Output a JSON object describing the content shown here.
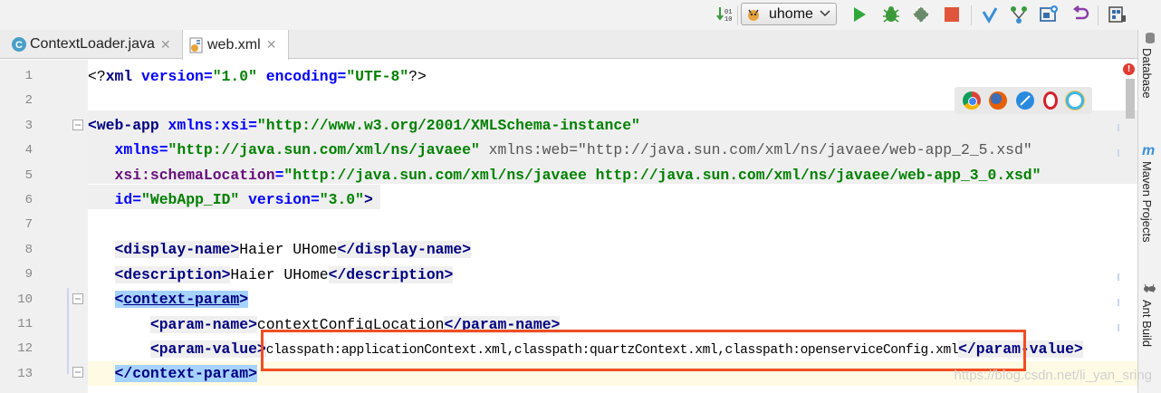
{
  "toolbar": {
    "run_config_label": "uhome",
    "icons": [
      "sort-icon",
      "run-config-icon",
      "run-icon",
      "debug-icon",
      "coverage-icon",
      "stop-icon",
      "vcs-update-icon",
      "vcs-branch-icon",
      "project-structure-icon",
      "revert-icon",
      "sdk-icon"
    ]
  },
  "tabs": [
    {
      "label": "ContextLoader.java",
      "icon": "java-class-icon",
      "active": false
    },
    {
      "label": "web.xml",
      "icon": "xml-file-icon",
      "active": true
    }
  ],
  "right_strip": {
    "database": "Database",
    "maven": "Maven Projects",
    "ant": "Ant Build"
  },
  "browsers": [
    "chrome-icon",
    "firefox-icon",
    "safari-icon",
    "opera-icon",
    "ie-icon"
  ],
  "line_numbers": [
    "1",
    "2",
    "3",
    "4",
    "5",
    "6",
    "7",
    "8",
    "9",
    "10",
    "11",
    "12",
    "13"
  ],
  "code": {
    "l1": {
      "open": "<?",
      "tag": "xml",
      "a1": " version",
      "eq1": "=",
      "v1": "\"1.0\"",
      "a2": " encoding",
      "eq2": "=",
      "v2": "\"UTF-8\"",
      "close": "?>"
    },
    "l3": {
      "lt": "<",
      "tag": "web-app",
      "sp": " ",
      "ns": "xmlns:xsi",
      "eq": "=",
      "v": "\"http://www.w3.org/2001/XMLSchema-instance\""
    },
    "l4": {
      "indent": "   ",
      "a": "xmlns",
      "eq": "=",
      "v": "\"http://java.sun.com/xml/ns/javaee\"",
      "a2": " xmlns:web",
      "eq2": "=",
      "v2": "\"http://java.sun.com/xml/ns/javaee/web-app_2_5.xsd\""
    },
    "l5": {
      "indent": "   ",
      "a": "xsi:schemaLocation",
      "eq": "=",
      "v": "\"http://java.sun.com/xml/ns/javaee http://java.sun.com/xml/ns/javaee/web-app_3_0.xsd\""
    },
    "l6": {
      "indent": "   ",
      "a": "id",
      "eq": "=",
      "v": "\"WebApp_ID\"",
      "a2": " version",
      "eq2": "=",
      "v2": "\"3.0\"",
      "close": ">"
    },
    "l8": {
      "indent": "   ",
      "lt": "<",
      "tag": "display-name",
      "gt": ">",
      "text": "Haier UHome",
      "lt2": "</",
      "tag2": "display-name",
      "gt2": ">"
    },
    "l9": {
      "indent": "   ",
      "lt": "<",
      "tag": "description",
      "gt": ">",
      "text": "Haier UHome",
      "lt2": "</",
      "tag2": "description",
      "gt2": ">"
    },
    "l10": {
      "indent": "   ",
      "lt": "<",
      "tag": "context-param",
      "gt": ">"
    },
    "l11": {
      "indent": "       ",
      "lt": "<",
      "tag": "param-name",
      "gt": ">",
      "text": "contextConfigLocation",
      "lt2": "</",
      "tag2": "param-name",
      "gt2": ">"
    },
    "l12": {
      "indent": "       ",
      "lt": "<",
      "tag": "param-value",
      "gt": ">",
      "text": "classpath:applicationContext.xml,classpath:quartzContext.xml,classpath:openserviceConfig.xml",
      "lt2": "</",
      "tag2": "param-value",
      "gt2": ">"
    },
    "l13": {
      "indent": "   ",
      "lt": "</",
      "tag": "context-param",
      "gt": ">"
    }
  },
  "watermark": "https://blog.csdn.net/li_yan_sring",
  "colors": {
    "tag": "#000080",
    "attr": "#0000ff",
    "value": "#008000",
    "namespace": "#660e7a",
    "highlight_box": "#f04e23",
    "selection": "#a6d2ff"
  }
}
